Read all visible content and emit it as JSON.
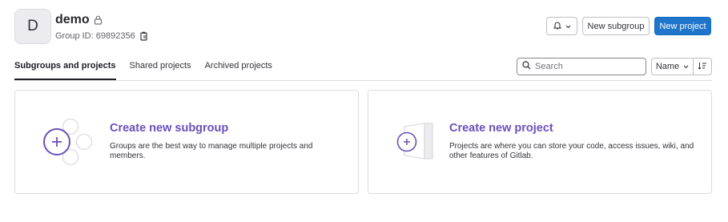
{
  "group": {
    "avatar_letter": "D",
    "name": "demo",
    "id_text": "Group ID: 69892356"
  },
  "header": {
    "new_subgroup_label": "New subgroup",
    "new_project_label": "New project"
  },
  "tabs": [
    {
      "label": "Subgroups and projects",
      "active": true
    },
    {
      "label": "Shared projects",
      "active": false
    },
    {
      "label": "Archived projects",
      "active": false
    }
  ],
  "search": {
    "placeholder": "Search",
    "value": ""
  },
  "sort": {
    "label": "Name"
  },
  "cards": {
    "subgroup": {
      "title": "Create new subgroup",
      "description": "Groups are the best way to manage multiple projects and members."
    },
    "project": {
      "title": "Create new project",
      "description": "Projects are where you can store your code, access issues, wiki, and other features of Gitlab."
    }
  },
  "colors": {
    "primary": "#1f75cb",
    "accent_purple": "#6b4fbb",
    "border": "#dcdcde"
  },
  "icons": [
    "lock-icon",
    "copy-icon",
    "bell-icon",
    "chevron-down-icon",
    "search-icon",
    "sort-direction-icon",
    "plus-circle-icon"
  ]
}
